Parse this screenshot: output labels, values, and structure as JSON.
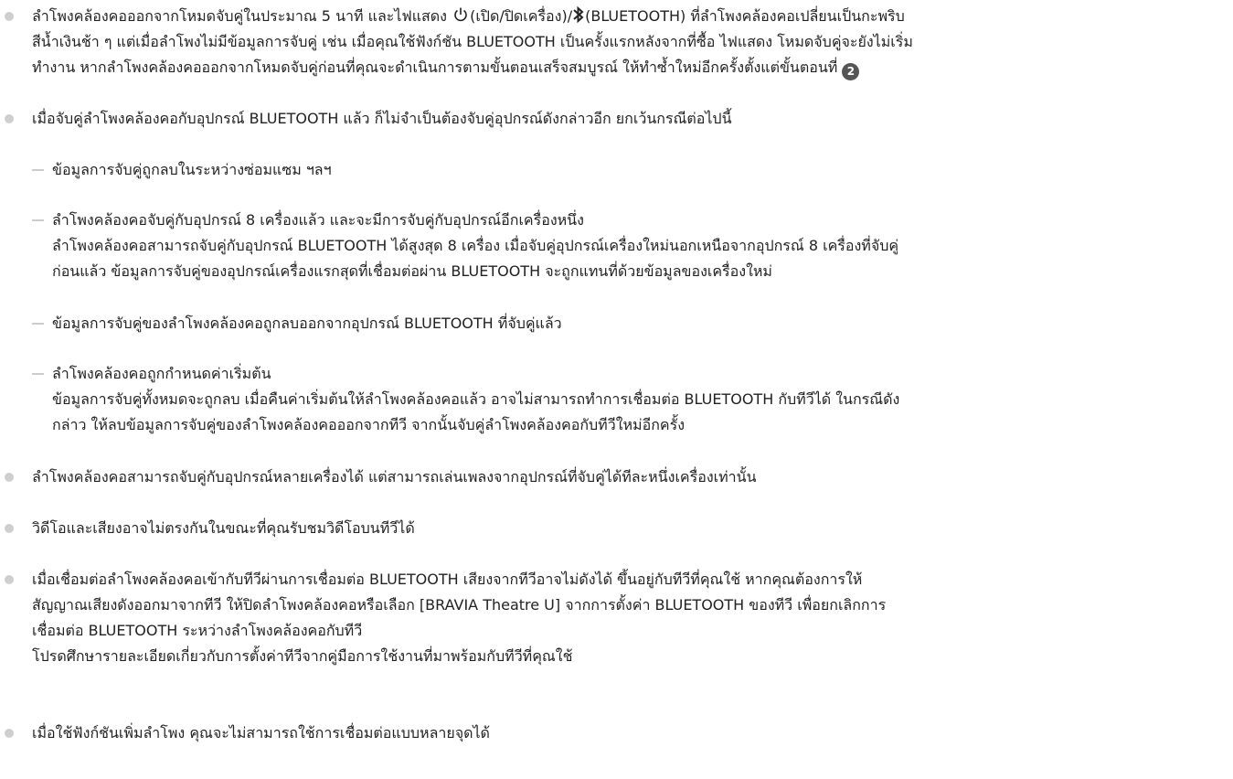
{
  "items": [
    {
      "lines": [
        "ลำโพงคล้องคอออกจากโหมดจับคู่ในประมาณ 5 นาที และไฟแสดง ",
        "สีน้ำเงินช้า ๆ แต่เมื่อลำโพงไม่มีข้อมูลการจับคู่ เช่น เมื่อคุณใช้ฟังก์ชัน BLUETOOTH เป็นครั้งแรกหลังจากที่ซื้อ ไฟแสดง โหมดจับคู่จะยังไม่เริ่ม",
        "ทำงาน หากลำโพงคล้องคอออกจากโหมดจับคู่ก่อนที่คุณจะดำเนินการตามขั้นตอนเสร็จสมบูรณ์ ให้ทำซ้ำใหม่อีกครั้งตั้งแต่ขั้นตอนที่ "
      ],
      "line1_mid": "(เปิด/ปิดเครื่อง)/",
      "line1_end": "(BLUETOOTH) ที่ลำโพงคล้องคอเปลี่ยนเป็นกะพริบ",
      "step_number": "2",
      "icons": [
        "power-icon",
        "bluetooth-icon",
        "step-2-badge-icon"
      ]
    },
    {
      "text": "เมื่อจับคู่ลำโพงคล้องคอกับอุปกรณ์ BLUETOOTH แล้ว ก็ไม่จำเป็นต้องจับคู่อุปกรณ์ดังกล่าวอีก ยกเว้นกรณีต่อไปนี้"
    }
  ],
  "sub_items": [
    {
      "title": "ข้อมูลการจับคู่ถูกลบในระหว่างซ่อมแซม ฯลฯ"
    },
    {
      "title": "ลำโพงคล้องคอจับคู่กับอุปกรณ์ 8 เครื่องแล้ว และจะมีการจับคู่กับอุปกรณ์อีกเครื่องหนึ่ง",
      "detail": [
        "ลำโพงคล้องคอสามารถจับคู่กับอุปกรณ์ BLUETOOTH ได้สูงสุด 8 เครื่อง เมื่อจับคู่อุปกรณ์เครื่องใหม่นอกเหนือจากอุปกรณ์ 8 เครื่องที่จับคู่",
        "ก่อนแล้ว ข้อมูลการจับคู่ของอุปกรณ์เครื่องแรกสุดที่เชื่อมต่อผ่าน BLUETOOTH จะถูกแทนที่ด้วยข้อมูลของเครื่องใหม่"
      ]
    },
    {
      "title": "ข้อมูลการจับคู่ของลำโพงคล้องคอถูกลบออกจากอุปกรณ์ BLUETOOTH ที่จับคู่แล้ว"
    },
    {
      "title": "ลำโพงคล้องคอถูกกำหนดค่าเริ่มต้น",
      "detail": [
        "ข้อมูลการจับคู่ทั้งหมดจะถูกลบ เมื่อคืนค่าเริ่มต้นให้ลำโพงคล้องคอแล้ว อาจไม่สามารถทำการเชื่อมต่อ BLUETOOTH กับทีวีได้ ในกรณีดัง",
        "กล่าว ให้ลบข้อมูลการจับคู่ของลำโพงคล้องคอออกจากทีวี จากนั้นจับคู่ลำโพงคล้องคอกับทีวีใหม่อีกครั้ง"
      ]
    }
  ],
  "bottom_items": [
    {
      "lines": [
        "ลำโพงคล้องคอสามารถจับคู่กับอุปกรณ์หลายเครื่องได้ แต่สามารถเล่นเพลงจากอุปกรณ์ที่จับคู่ได้ทีละหนึ่งเครื่องเท่านั้น"
      ]
    },
    {
      "lines": [
        "วิดีโอและเสียงอาจไม่ตรงกันในขณะที่คุณรับชมวิดีโอบนทีวีได้"
      ]
    },
    {
      "lines": [
        "เมื่อเชื่อมต่อลำโพงคล้องคอเข้ากับทีวีผ่านการเชื่อมต่อ BLUETOOTH เสียงจากทีวีอาจไม่ดังได้ ขึ้นอยู่กับทีวีที่คุณใช้ หากคุณต้องการให้",
        "สัญญาณเสียงดังออกมาจากทีวี ให้ปิดลำโพงคล้องคอหรือเลือก [BRAVIA Theatre U] จากการตั้งค่า BLUETOOTH ของทีวี เพื่อยกเลิกการ",
        "เชื่อมต่อ BLUETOOTH ระหว่างลำโพงคล้องคอกับทีวี",
        "โปรดศึกษารายละเอียดเกี่ยวกับการตั้งค่าทีวีจากคู่มือการใช้งานที่มาพร้อมกับทีวีที่คุณใช้"
      ]
    },
    {
      "lines": [
        "เมื่อใช้ฟังก์ชันเพิ่มลำโพง คุณจะไม่สามารถใช้การเชื่อมต่อแบบหลายจุดได้"
      ]
    }
  ],
  "colors": {
    "text": "#222222",
    "bullet": "#cfcfcf",
    "dash": "#cccccc",
    "badge": "#555555"
  }
}
